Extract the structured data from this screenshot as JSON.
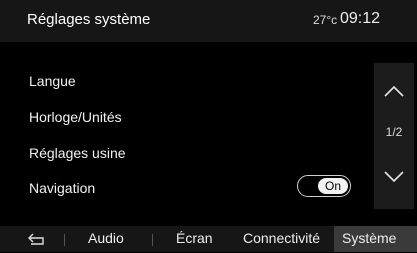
{
  "header": {
    "title": "Réglages système",
    "temperature": "27°c",
    "time": "09:12"
  },
  "menu": {
    "items": [
      {
        "label": "Langue"
      },
      {
        "label": "Horloge/Unités"
      },
      {
        "label": "Réglages usine"
      },
      {
        "label": "Navigation"
      }
    ],
    "navigation_toggle": {
      "value": "On"
    }
  },
  "scroll": {
    "page_indicator": "1/2",
    "up_icon": "chevron-up-icon",
    "down_icon": "chevron-down-icon"
  },
  "tabs": {
    "back_icon": "back-arrow-icon",
    "items": [
      {
        "label": "Audio"
      },
      {
        "label": "Écran"
      },
      {
        "label": "Connectivité"
      },
      {
        "label": "Système"
      }
    ],
    "active": "Système"
  }
}
